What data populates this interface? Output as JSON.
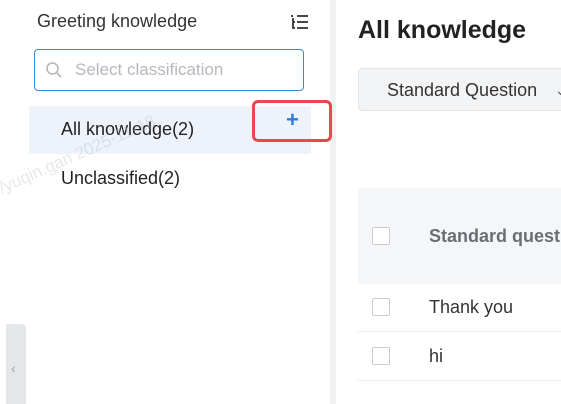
{
  "sidebar": {
    "title": "Greeting knowledge",
    "search_placeholder": "Select classification",
    "items": [
      {
        "label": "All knowledge(2)"
      },
      {
        "label": "Unclassified(2)"
      }
    ],
    "add_label": "+",
    "collapse_icon": "chevron-left-icon",
    "collapse_label": "‹"
  },
  "main": {
    "title": "All knowledge",
    "type_select": {
      "value": "Standard Question",
      "chevron": "⌄"
    },
    "table": {
      "header": "Standard question",
      "rows": [
        {
          "text": "Thank you"
        },
        {
          "text": "hi"
        }
      ]
    }
  },
  "watermark": "/yuqin.gan  2025-11-18",
  "colors": {
    "accent": "#2f7bdc",
    "highlight_border": "#e8484d",
    "active_bg": "#eef3fb",
    "page_bg": "#f0f1f3"
  }
}
